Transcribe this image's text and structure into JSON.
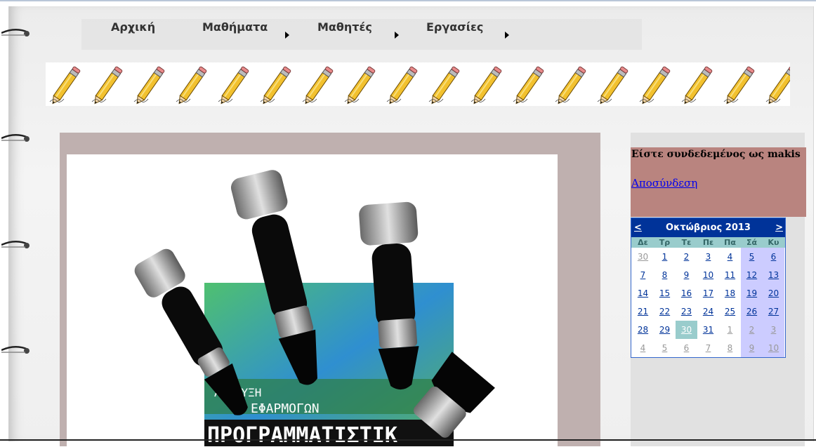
{
  "menu": {
    "items": [
      {
        "label": "Αρχική"
      },
      {
        "label": "Μαθήματα"
      },
      {
        "label": "Μαθητές"
      },
      {
        "label": "Εργασίες"
      }
    ]
  },
  "sidebar": {
    "login_text": "Είστε συνδεδεμένος ως makis",
    "logout_label": "Αποσύνδεση"
  },
  "calendar": {
    "prev": "<",
    "next": ">",
    "title": "Οκτώβριος 2013",
    "weekdays": [
      "Δε",
      "Τρ",
      "Τε",
      "Πε",
      "Πα",
      "Σά",
      "Κυ"
    ],
    "weeks": [
      [
        "30",
        "1",
        "2",
        "3",
        "4",
        "5",
        "6"
      ],
      [
        "7",
        "8",
        "9",
        "10",
        "11",
        "12",
        "13"
      ],
      [
        "14",
        "15",
        "16",
        "17",
        "18",
        "19",
        "20"
      ],
      [
        "21",
        "22",
        "23",
        "24",
        "25",
        "26",
        "27"
      ],
      [
        "28",
        "29",
        "30",
        "31",
        "1",
        "2",
        "3"
      ],
      [
        "4",
        "5",
        "6",
        "7",
        "8",
        "9",
        "10"
      ]
    ]
  },
  "image": {
    "caption_line1": "Α  ΠΤΥΞΗ",
    "caption_line2": "ΕΦΑΡΜΟΓΩΝ",
    "caption_line3": "ΠΡΟΓΡΑΜΜΑΤΙΣΤΙΚ"
  },
  "colors": {
    "calendar_header": "#003399",
    "calendar_weekdays": "#99cccc",
    "calendar_weekend": "#ccccff",
    "login_box": "#b9847f",
    "content_panel": "#bfb0af"
  }
}
